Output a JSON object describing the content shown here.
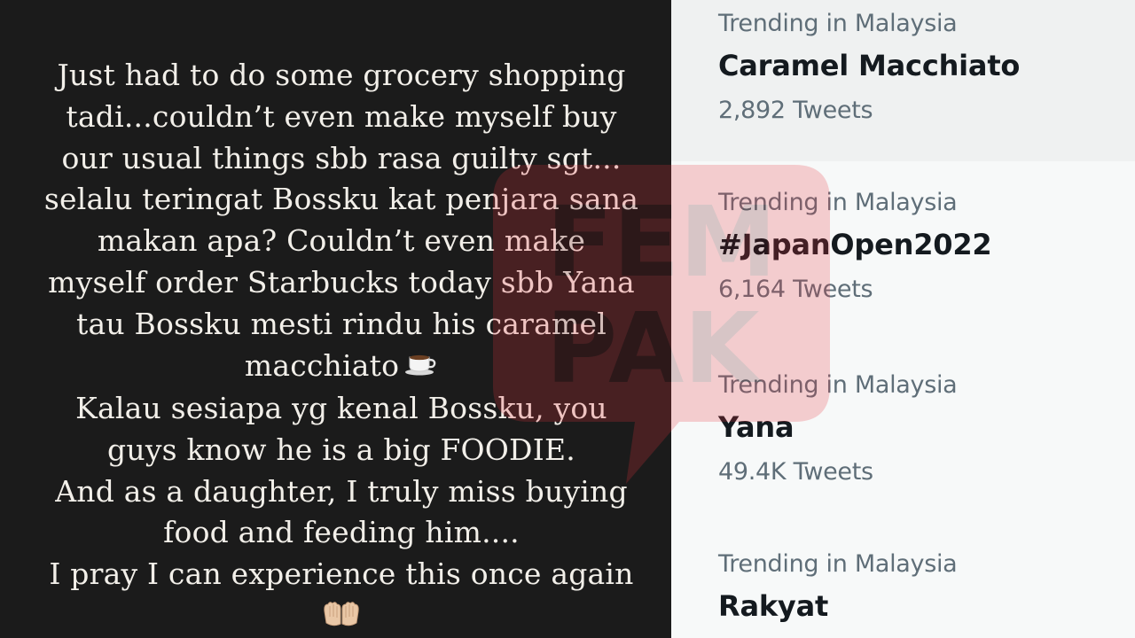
{
  "story": {
    "lines": [
      "Just had to do some grocery shopping",
      "tadi...couldn’t even make myself buy",
      "our usual things sbb rasa guilty sgt...",
      "selalu teringat Bossku kat penjara sana",
      "makan apa? Couldn’t even make",
      "myself order Starbucks today sbb Yana",
      "tau Bossku mesti rindu his caramel",
      "macchiato",
      "Kalau sesiapa yg kenal Bossku, you",
      "guys know he is a big FOODIE.",
      "And as a daughter, I truly miss buying",
      "food and feeding him....",
      "I pray I can experience this once again"
    ],
    "icons": [
      "coffee-cup-emoji",
      "open-hands-emoji"
    ]
  },
  "trends": [
    {
      "context": "Trending in Malaysia",
      "title": "Caramel Macchiato",
      "count": "2,892 Tweets"
    },
    {
      "context": "Trending in Malaysia",
      "title": "#JapanOpen2022",
      "count": "6,164 Tweets"
    },
    {
      "context": "Trending in Malaysia",
      "title": "Yana",
      "count": "49.4K Tweets"
    },
    {
      "context": "Trending in Malaysia",
      "title": "Rakyat"
    }
  ],
  "watermark": {
    "text": "FEM PAK",
    "color": "#e8323c"
  },
  "colors": {
    "story_bg": "#1b1b1b",
    "story_text": "#f2efe9",
    "trends_bg": "#f7f9f9",
    "trend_highlight_bg": "#eff1f1",
    "secondary_text": "#5f6e78",
    "primary_text": "#141a1f"
  }
}
